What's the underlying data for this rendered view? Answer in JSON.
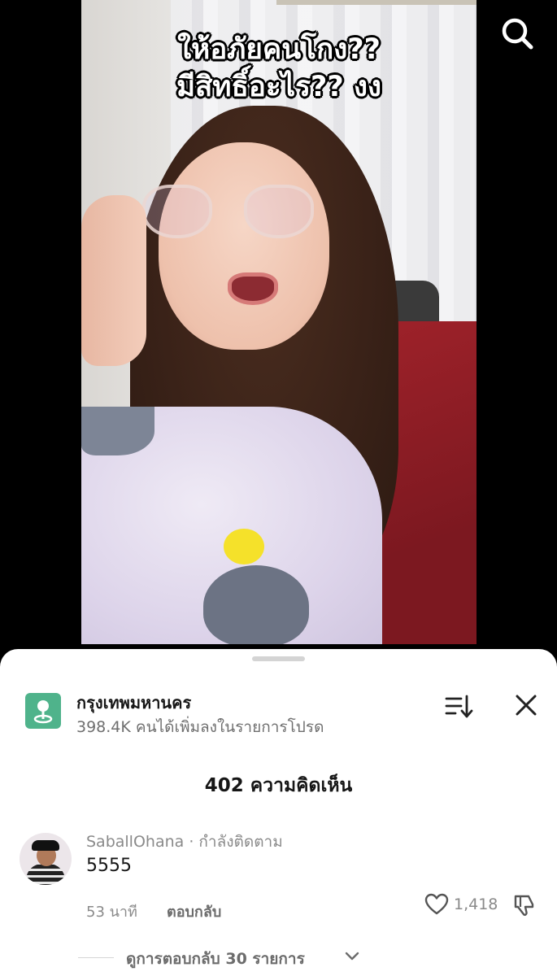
{
  "video": {
    "caption_line1": "ให้อภัยคนโกง??",
    "caption_line2": "มีสิทธิ์อะไร?? งง"
  },
  "top_bar": {
    "search_icon": "search-icon"
  },
  "sheet": {
    "location": {
      "icon": "location-pin-icon",
      "title": "กรุงเทพมหานคร",
      "subtitle": "398.4K คนได้เพิ่มลงในรายการโปรด"
    },
    "sort_icon": "sort-icon",
    "close_icon": "close-icon",
    "comment_count": "402 ความคิดเห็น",
    "comments": [
      {
        "username": "SaballOhana",
        "separator": " · ",
        "status": "กำลังติดตาม",
        "text": "5555",
        "time": "53 นาที",
        "reply_label": "ตอบกลับ",
        "likes": "1,418",
        "view_replies": "ดูการตอบกลับ 30 รายการ"
      }
    ]
  },
  "colors": {
    "accent_location": "#4fb38b",
    "sheet_bg": "#ffffff",
    "page_bg": "#000000"
  }
}
